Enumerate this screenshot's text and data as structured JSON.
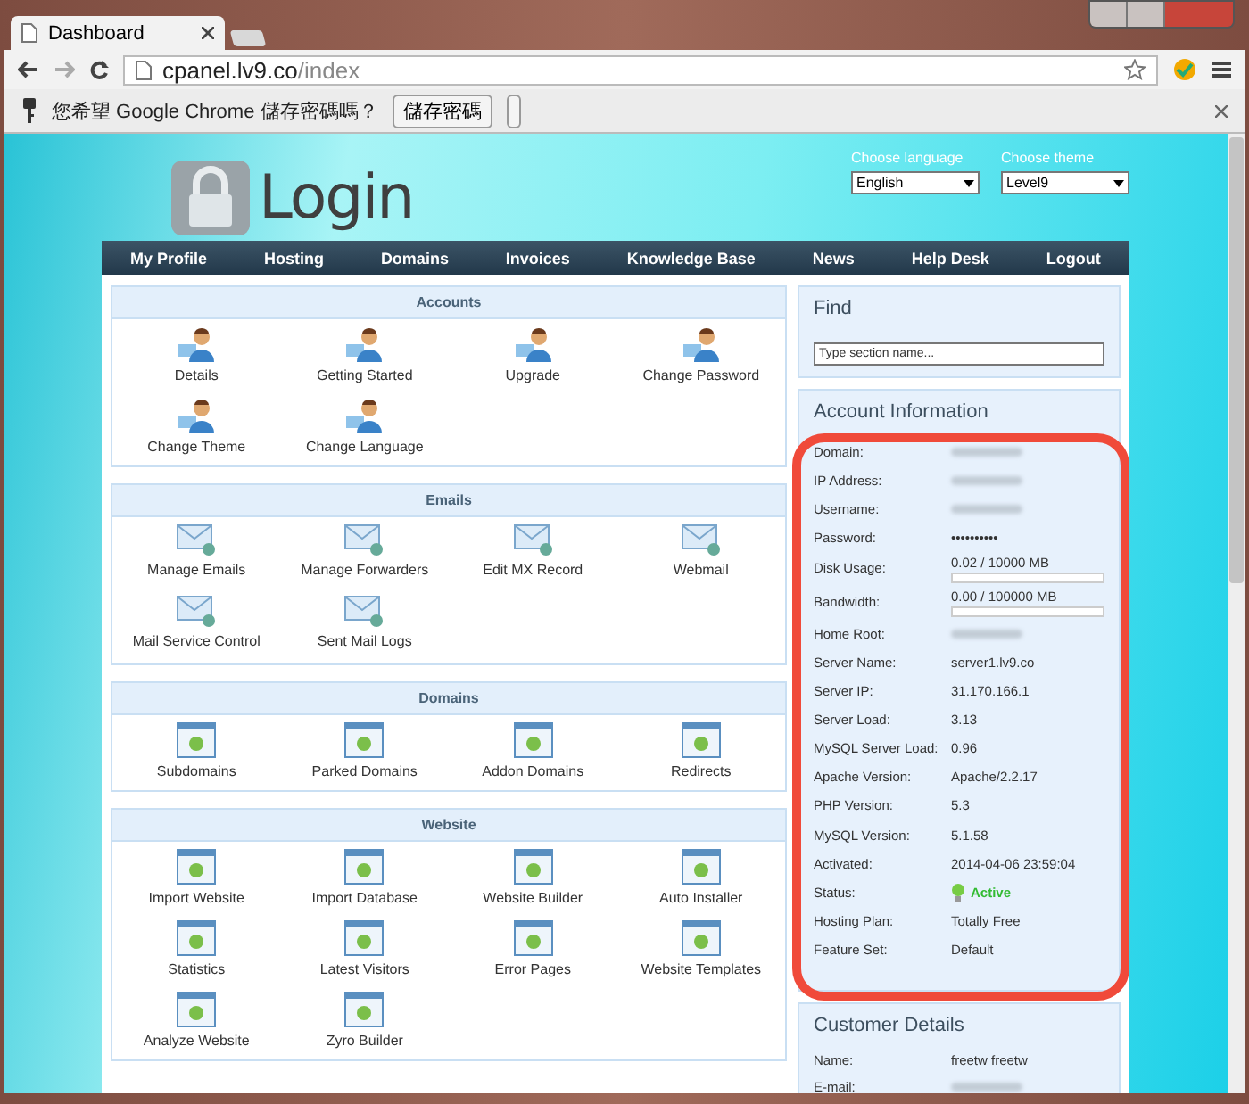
{
  "browser": {
    "tab_title": "Dashboard",
    "url_host": "cpanel.lv9.co",
    "url_path": "/index",
    "infobar_text": "您希望 Google Chrome 儲存密碼嗎？",
    "infobar_button": "儲存密碼"
  },
  "header": {
    "logo_text": "Login",
    "language_label": "Choose language",
    "language_value": "English",
    "theme_label": "Choose theme",
    "theme_value": "Level9"
  },
  "nav": [
    "My Profile",
    "Hosting",
    "Domains",
    "Invoices",
    "Knowledge Base",
    "News",
    "Help Desk",
    "Logout"
  ],
  "sections": [
    {
      "title": "Accounts",
      "items": [
        "Details",
        "Getting Started",
        "Upgrade",
        "Change Password",
        "Change Theme",
        "Change Language"
      ]
    },
    {
      "title": "Emails",
      "items": [
        "Manage Emails",
        "Manage Forwarders",
        "Edit MX Record",
        "Webmail",
        "Mail Service Control",
        "Sent Mail Logs"
      ]
    },
    {
      "title": "Domains",
      "items": [
        "Subdomains",
        "Parked Domains",
        "Addon Domains",
        "Redirects"
      ]
    },
    {
      "title": "Website",
      "items": [
        "Import Website",
        "Import Database",
        "Website Builder",
        "Auto Installer",
        "Statistics",
        "Latest Visitors",
        "Error Pages",
        "Website Templates",
        "Analyze Website",
        "Zyro Builder"
      ]
    }
  ],
  "find": {
    "title": "Find",
    "placeholder": "Type section name..."
  },
  "account_info": {
    "title": "Account Information",
    "rows": [
      {
        "kind": "redacted",
        "label": "Domain:"
      },
      {
        "kind": "redacted",
        "label": "IP Address:"
      },
      {
        "kind": "redacted",
        "label": "Username:"
      },
      {
        "kind": "text",
        "label": "Password:",
        "value": "••••••••••"
      },
      {
        "kind": "meter",
        "label": "Disk Usage:",
        "value": "0.02 / 10000 MB",
        "level": 0.0
      },
      {
        "kind": "meter",
        "label": "Bandwidth:",
        "value": "0.00 / 100000 MB",
        "level": 0.0
      },
      {
        "kind": "redacted",
        "label": "Home Root:"
      },
      {
        "kind": "text",
        "label": "Server Name:",
        "value": "server1.lv9.co"
      },
      {
        "kind": "text",
        "label": "Server IP:",
        "value": "31.170.166.1"
      },
      {
        "kind": "text",
        "label": "Server Load:",
        "value": "3.13"
      },
      {
        "kind": "text",
        "label": "MySQL Server Load:",
        "value": "0.96"
      },
      {
        "kind": "text",
        "label": "Apache Version:",
        "value": "Apache/2.2.17"
      },
      {
        "kind": "text",
        "label": "PHP Version:",
        "value": "5.3"
      },
      {
        "kind": "text",
        "label": "MySQL Version:",
        "value": "5.1.58"
      },
      {
        "kind": "text",
        "label": "Activated:",
        "value": "2014-04-06 23:59:04"
      },
      {
        "kind": "status",
        "label": "Status:",
        "value": "Active"
      },
      {
        "kind": "text",
        "label": "Hosting Plan:",
        "value": "Totally Free"
      },
      {
        "kind": "text",
        "label": "Feature Set:",
        "value": "Default"
      }
    ]
  },
  "customer_details": {
    "title": "Customer Details",
    "rows": [
      {
        "kind": "text",
        "label": "Name:",
        "value": "freetw freetw"
      },
      {
        "kind": "redacted",
        "label": "E-mail:"
      }
    ]
  }
}
